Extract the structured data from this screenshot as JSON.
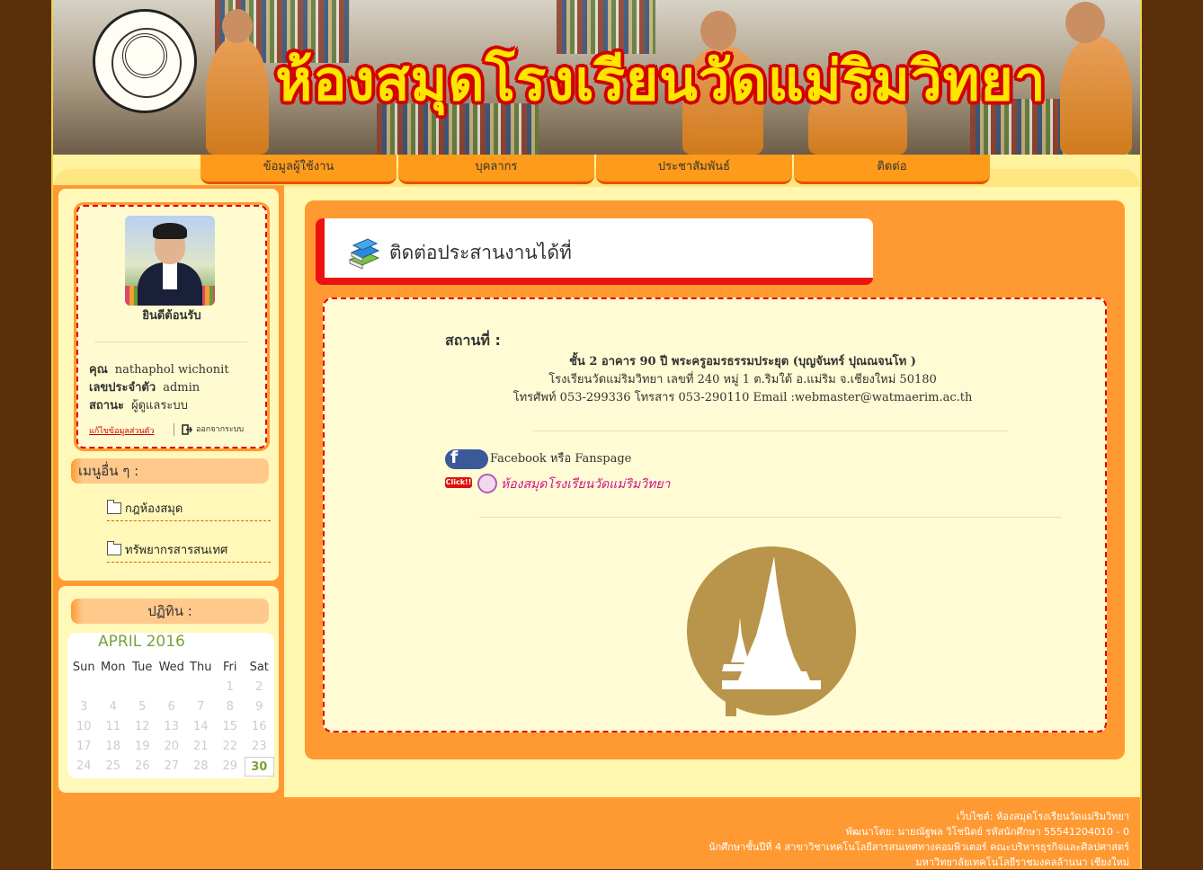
{
  "banner": {
    "title": "ห้องสมุดโรงเรียนวัดแม่ริมวิทยา"
  },
  "nav": {
    "items": [
      {
        "label": "ข้อมูลผู้ใช้งาน"
      },
      {
        "label": "บุคลากร"
      },
      {
        "label": "ประชาสัมพันธ์"
      },
      {
        "label": "ติดต่อ"
      }
    ]
  },
  "profile": {
    "welcome": "ยินดีต้อนรับ",
    "name_label": "คุณ",
    "name_value": "nathaphol wichonit",
    "id_label": "เลขประจำตัว",
    "id_value": "admin",
    "status_label": "สถานะ",
    "status_value": "ผู้ดูแลระบบ",
    "edit_link": "แก้ไขข้อมูลส่วนตัว",
    "logout": "ออกจากระบบ"
  },
  "other_menu": {
    "heading": "เมนูอื่น ๆ :",
    "items": [
      {
        "label": "กฎห้องสมุด"
      },
      {
        "label": "ทรัพยากรสารสนเทศ"
      }
    ]
  },
  "calendar": {
    "heading": "ปฏิทิน :",
    "month_title": "APRIL 2016",
    "weekdays": [
      "Sun",
      "Mon",
      "Tue",
      "Wed",
      "Thu",
      "Fri",
      "Sat"
    ],
    "weeks": [
      [
        "",
        "",
        "",
        "",
        "",
        "1",
        "2"
      ],
      [
        "3",
        "4",
        "5",
        "6",
        "7",
        "8",
        "9"
      ],
      [
        "10",
        "11",
        "12",
        "13",
        "14",
        "15",
        "16"
      ],
      [
        "17",
        "18",
        "19",
        "20",
        "21",
        "22",
        "23"
      ],
      [
        "24",
        "25",
        "26",
        "27",
        "28",
        "29",
        "30"
      ]
    ],
    "today": "30"
  },
  "content": {
    "title": "ติดต่อประสานงานได้ที่",
    "location_label": "สถานที่ :",
    "address_line1": "ชั้น 2 อาคาร 90 ปี พระครูอมรธรรมประยุต (บุญจันทร์ ปุณณจนโท )",
    "address_line2": "โรงเรียนวัดแม่ริมวิทยา เลขที่ 240 หมู่ 1 ต.ริมใต้ อ.แม่ริม จ.เชียงใหม่ 50180",
    "address_line3": "โทรศัพท์ 053-299336 โทรสาร 053-290110 Email :webmaster@watmaerim.ac.th",
    "facebook_text": "Facebook หรือ Fanspage",
    "click_tag": "Click!!",
    "fanpage_link": "ห้องสมุดโรงเรียนวัดแม่ริมวิทยา"
  },
  "footer": {
    "line1": "เว็บไซต์: ห้องสมุดโรงเรียนวัดแม่ริมวิทยา",
    "line2": "พัฒนาโดย: นายณัฐพล วิโชนิตย์ รหัสนักศึกษา 55541204010 - 0",
    "line3": "นักศึกษาชั้นปีที่ 4 สาขาวิชาเทคโนโลยีสารสนเทศทางคอมพิวเตอร์ คณะบริหารธุรกิจและศิลปศาสตร์",
    "line4": "มหาวิทยาลัยเทคโนโลยีราชมงคลล้านนา เชียงใหม่"
  },
  "colors": {
    "page_bg": "#fff7ad",
    "outer_bg": "#5b2f0a",
    "accent_orange": "#ff9a33",
    "accent_red": "#ee1111",
    "emblem_gold": "#b8954a"
  }
}
